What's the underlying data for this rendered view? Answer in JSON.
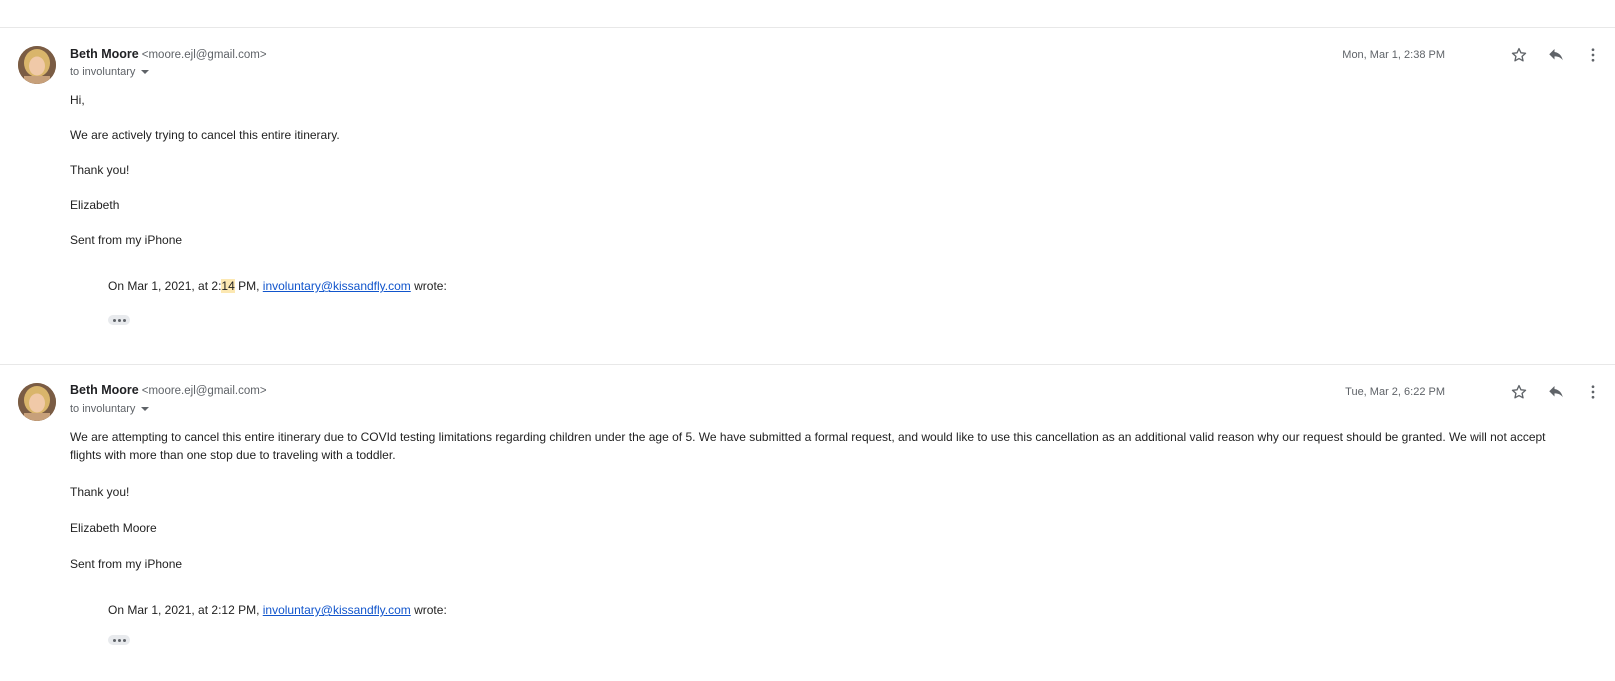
{
  "messages": [
    {
      "sender_name": "Beth Moore",
      "sender_email": "<moore.ejl@gmail.com>",
      "recipient": "to involuntary",
      "timestamp": "Mon, Mar 1, 2:38 PM",
      "lines": [
        "Hi,",
        "We are actively trying to cancel this entire itinerary.",
        "Thank you!",
        "Elizabeth",
        "Sent from my iPhone"
      ],
      "quote": {
        "prefix": "On Mar 1, 2021, at 2:",
        "highlight": "14",
        "middle": " PM, ",
        "link": "involuntary@kissandfly.com",
        "suffix": " wrote:"
      }
    },
    {
      "sender_name": "Beth Moore",
      "sender_email": "<moore.ejl@gmail.com>",
      "recipient": "to involuntary",
      "timestamp": "Tue, Mar 2, 6:22 PM",
      "paragraph": "We are attempting to cancel this entire itinerary due to COVId testing limitations regarding children under the age of 5. We have submitted a formal request, and would like to use this cancellation as an additional valid reason why our request should be granted. We will not accept flights with more than one stop due to traveling with a toddler.",
      "lines": [
        "Thank you!",
        "Elizabeth Moore",
        "Sent from my iPhone"
      ],
      "quote": {
        "prefix": "On Mar 1, 2021, at 2:12 PM, ",
        "link": "involuntary@kissandfly.com",
        "suffix": " wrote:"
      }
    }
  ],
  "icons": {
    "star": "star-icon",
    "reply": "reply-icon",
    "more": "more-vert-icon",
    "expand": "expand-quoted-icon"
  },
  "colors": {
    "link": "#1155cc",
    "highlight": "#fce8b2",
    "muted": "#5f6368"
  }
}
